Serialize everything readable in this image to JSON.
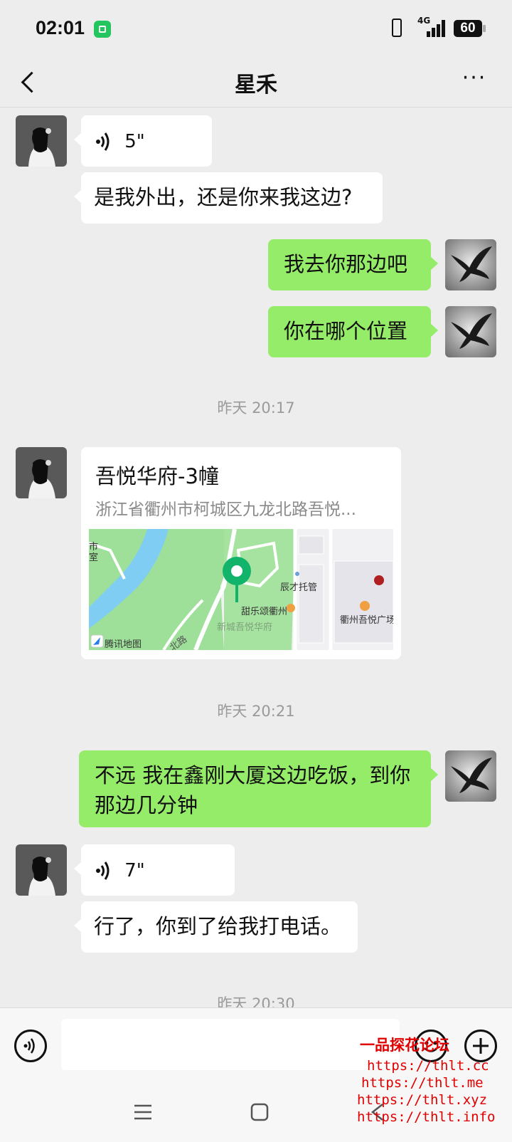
{
  "status": {
    "time": "02:01",
    "network": "4G",
    "battery": "60"
  },
  "header": {
    "title": "星禾",
    "more": "···"
  },
  "messages": [
    {
      "dur": "5\""
    },
    {
      "text": "是我外出，还是你来我这边?"
    },
    {
      "text": "我去你那边吧"
    },
    {
      "text": "你在哪个位置"
    },
    {
      "ts": "昨天 20:17"
    },
    {
      "loc_name": "吾悦华府-3幢",
      "loc_addr": "浙江省衢州市柯城区九龙北路吾悦..."
    },
    {
      "ts": "昨天 20:21"
    },
    {
      "text": "不远 我在鑫刚大厦这边吃饭，到你那边几分钟"
    },
    {
      "dur": "7\""
    },
    {
      "text": "行了，你到了给我打电话。"
    },
    {
      "ts": "昨天 20:30"
    }
  ],
  "map": {
    "labels": [
      "市",
      "室",
      "辰才托管",
      "甜乐颂衢州",
      "衢州吾悦广场",
      "新城吾悦华府",
      "北路",
      "腾讯地图"
    ],
    "colors": {
      "green": "#9ee09a",
      "water": "#7fcdf3",
      "pin": "#12b36b"
    }
  },
  "watermark": [
    "一品探花论坛",
    "https://thlt.cc",
    "https://thlt.me",
    "https://thlt.xyz",
    "https://thlt.info"
  ]
}
